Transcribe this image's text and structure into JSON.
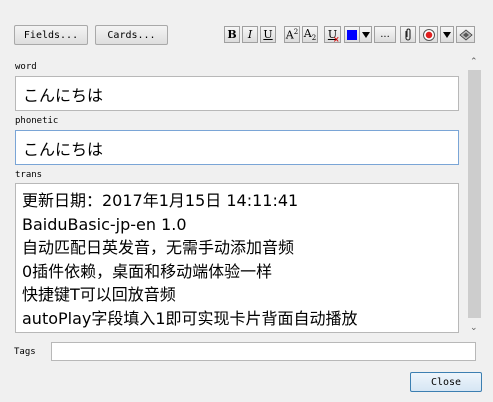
{
  "toolbar": {
    "fields_label": "Fields...",
    "cards_label": "Cards...",
    "bold": "B",
    "italic": "I",
    "underline": "U",
    "superscript_base": "A",
    "superscript_mark": "2",
    "subscript_base": "A",
    "subscript_mark": "2",
    "clear_format": "U",
    "more": "...",
    "text_color": "#0000ff",
    "record_color": "#e02020"
  },
  "fields": [
    {
      "label": "word",
      "value": "こんにちは"
    },
    {
      "label": "phonetic",
      "value": "こんにちは"
    },
    {
      "label": "trans",
      "lines": [
        "更新日期：2017年1月15日 14:11:41",
        "BaiduBasic-jp-en 1.0",
        "自动匹配日英发音，无需手动添加音频",
        "0插件依赖，桌面和移动端体验一样",
        "快捷键T可以回放音频",
        "autoPlay字段填入1即可实现卡片背面自动播放"
      ]
    }
  ],
  "tags": {
    "label": "Tags",
    "value": ""
  },
  "close_label": "Close"
}
